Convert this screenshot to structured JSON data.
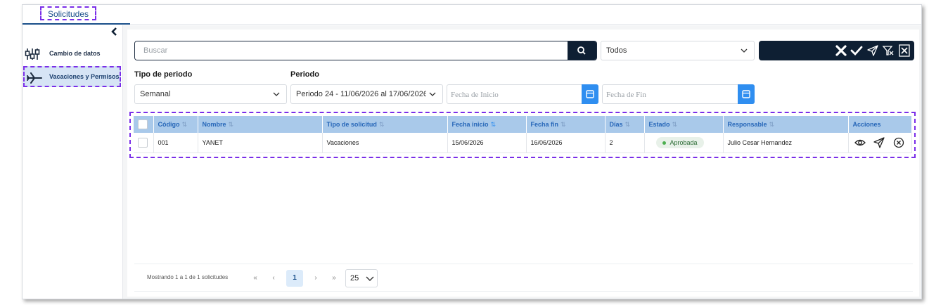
{
  "tabs": {
    "active_label": "Solicitudes"
  },
  "sidebar": {
    "items": [
      {
        "label": "Cambio de datos",
        "icon": "sliders-icon"
      },
      {
        "label": "Vacaciones y Permisos",
        "icon": "airplane-icon"
      }
    ]
  },
  "search": {
    "placeholder": "Buscar"
  },
  "status_filter": {
    "value": "Todos"
  },
  "filters": {
    "tipo_label": "Tipo de periodo",
    "tipo_value": "Semanal",
    "periodo_label": "Periodo",
    "periodo_value": "Periodo 24 - 11/06/2026 al 17/06/2026",
    "fecha_inicio_placeholder": "Fecha de Inicio",
    "fecha_fin_placeholder": "Fecha de Fin"
  },
  "table": {
    "columns": [
      "Código",
      "Nombre",
      "Tipo de solicitud",
      "Fecha inicio",
      "Fecha fin",
      "Días",
      "Estado",
      "Responsable",
      "Acciones"
    ],
    "rows": [
      {
        "codigo": "001",
        "nombre": "YANET",
        "tipo": "Vacaciones",
        "fecha_inicio": "15/06/2026",
        "fecha_fin": "16/06/2026",
        "dias": "2",
        "estado": "Aprobada",
        "responsable": "Julio Cesar Hernandez"
      }
    ]
  },
  "pagination": {
    "info": "Mostrando 1 a 1 de 1 solicitudes",
    "first": "«",
    "prev": "‹",
    "current": "1",
    "next": "›",
    "last": "»",
    "per_page": "25"
  },
  "colors": {
    "accent": "#2f8ef0",
    "dark": "#0e1f33",
    "header": "#a9c9ea",
    "highlight": "#7a2ee8"
  }
}
